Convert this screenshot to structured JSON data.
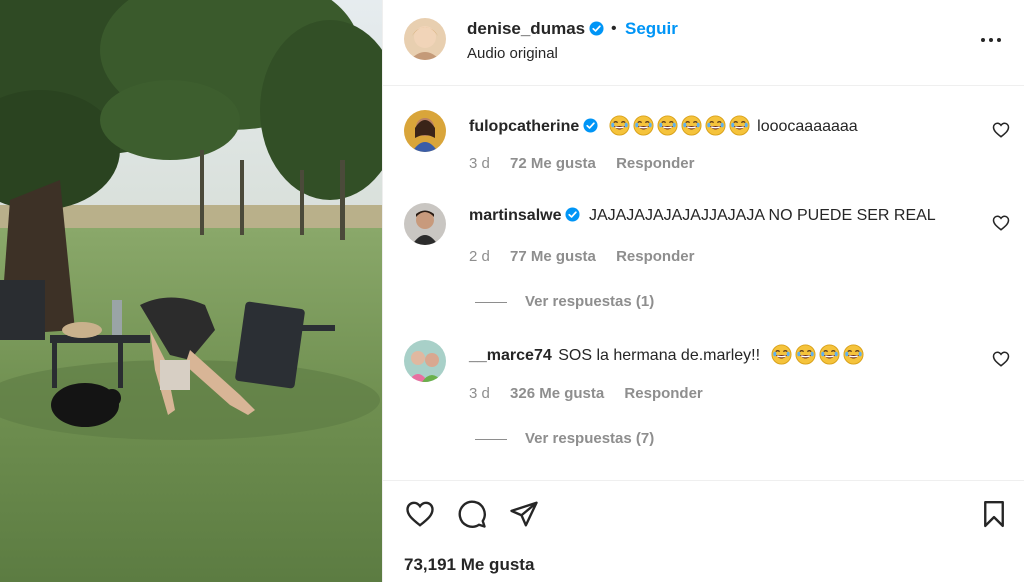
{
  "post": {
    "username": "denise_dumas",
    "follow_label": "Seguir",
    "separator": "•",
    "audio": "Audio original",
    "accent_color": "#0095f6"
  },
  "comments": [
    {
      "username": "fulopcatherine",
      "verified": true,
      "emoji_count": 6,
      "text": "looocaaaaaaa",
      "time": "3 d",
      "likes": "72 Me gusta",
      "reply": "Responder"
    },
    {
      "username": "martinsalwe",
      "verified": true,
      "text": "JAJAJAJAJAJAJJAJAJA NO PUEDE SER REAL",
      "time": "2 d",
      "likes": "77 Me gusta",
      "reply": "Responder",
      "view_replies": "Ver respuestas (1)"
    },
    {
      "username": "__marce74",
      "verified": false,
      "text": "SOS la hermana de.marley!!",
      "emoji_count": 4,
      "time": "3 d",
      "likes": "326 Me gusta",
      "reply": "Responder",
      "view_replies": "Ver respuestas (7)"
    }
  ],
  "footer": {
    "like_count": "73,191 Me gusta",
    "icons": [
      "heart-icon",
      "comment-icon",
      "share-icon",
      "bookmark-icon"
    ]
  }
}
